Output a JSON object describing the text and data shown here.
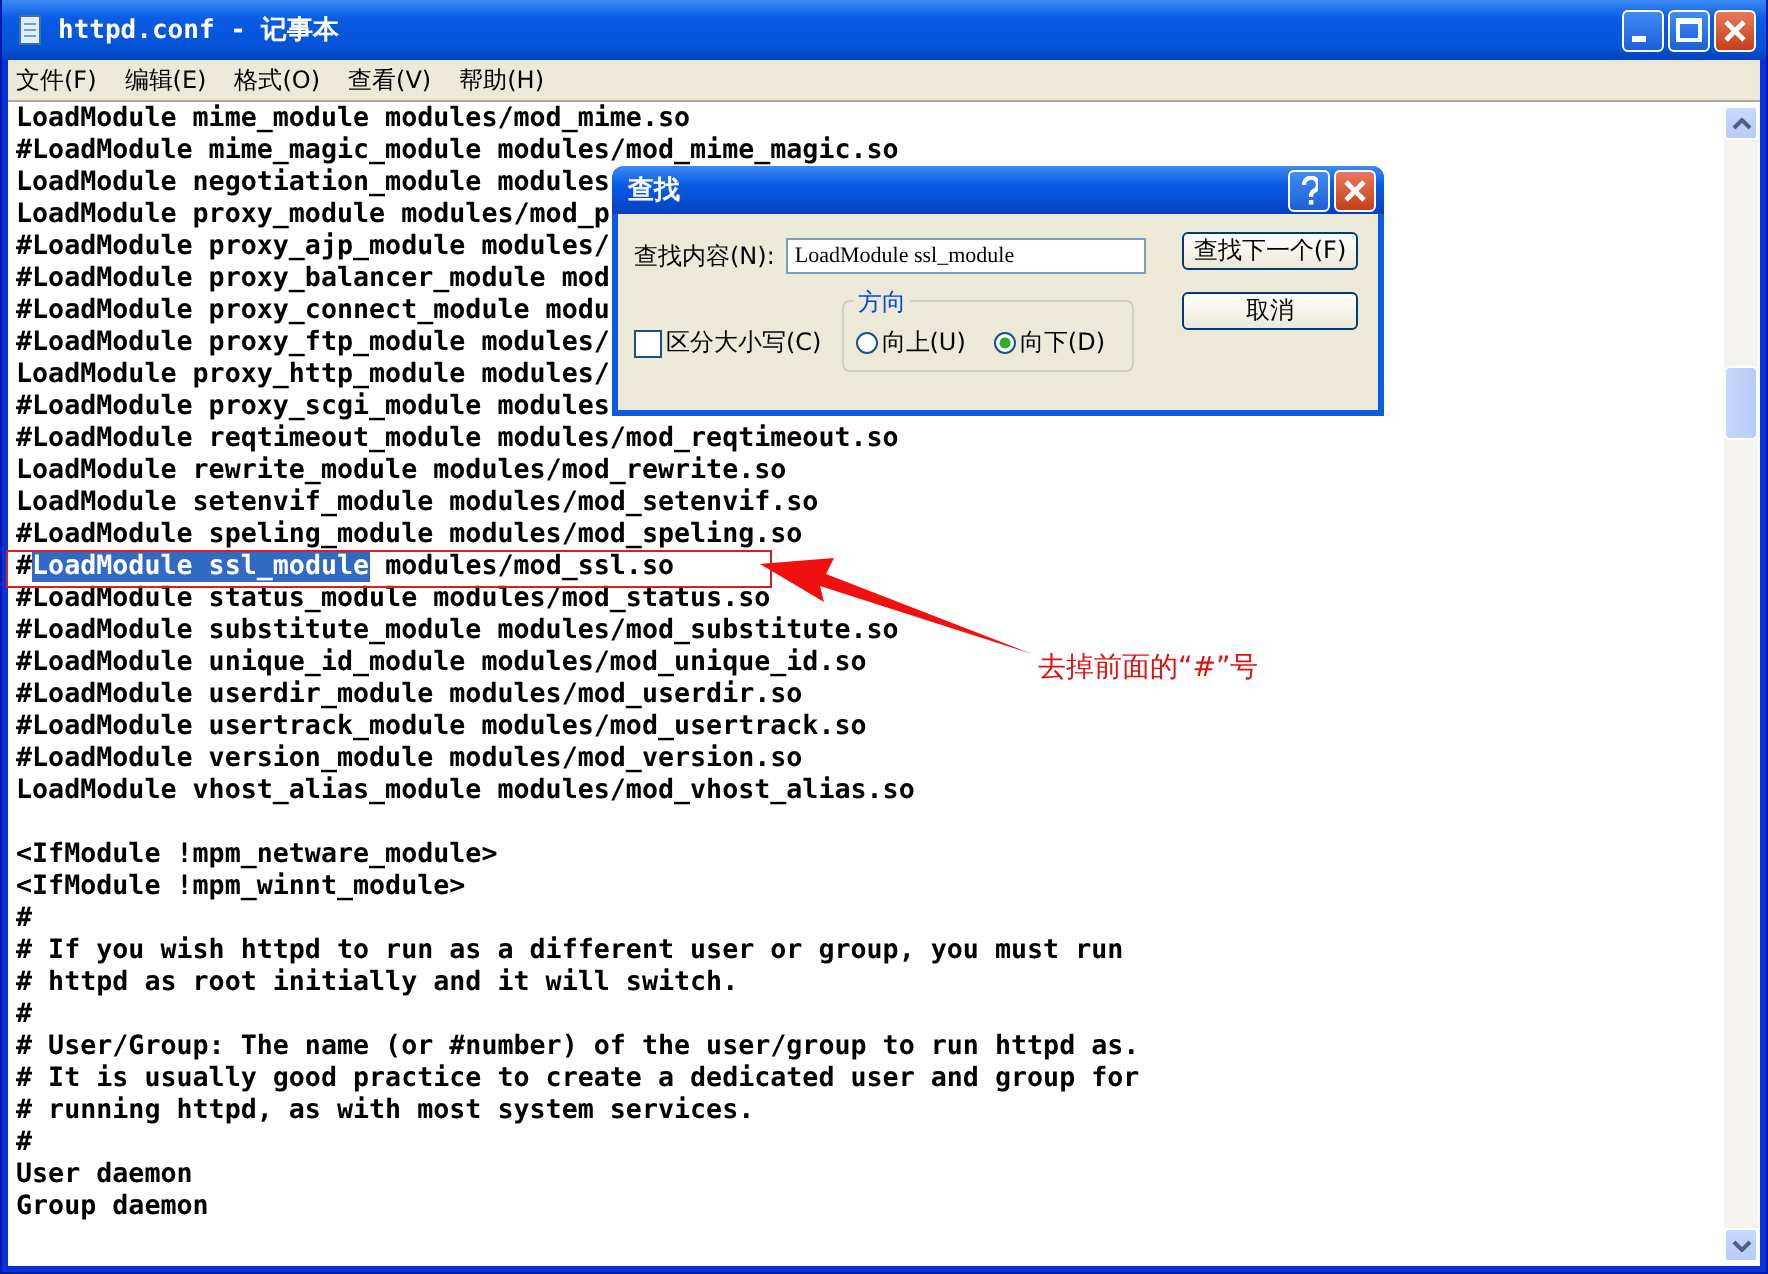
{
  "window": {
    "title": "httpd.conf - 记事本"
  },
  "menu": [
    {
      "label": "文件(F)"
    },
    {
      "label": "编辑(E)"
    },
    {
      "label": "格式(O)"
    },
    {
      "label": "查看(V)"
    },
    {
      "label": "帮助(H)"
    }
  ],
  "editor": {
    "lines": [
      {
        "text": "LoadModule mime_module modules/mod_mime.so"
      },
      {
        "text": "#LoadModule mime_magic_module modules/mod_mime_magic.so"
      },
      {
        "text": "LoadModule negotiation_module modules"
      },
      {
        "text": "LoadModule proxy_module modules/mod_p"
      },
      {
        "text": "#LoadModule proxy_ajp_module modules/"
      },
      {
        "text": "#LoadModule proxy_balancer_module mod"
      },
      {
        "text": "#LoadModule proxy_connect_module modu"
      },
      {
        "text": "#LoadModule proxy_ftp_module modules/"
      },
      {
        "text": "LoadModule proxy_http_module modules/"
      },
      {
        "text": "#LoadModule proxy_scgi_module modules"
      },
      {
        "text": "#LoadModule reqtimeout_module modules/mod_reqtimeout.so"
      },
      {
        "text": "LoadModule rewrite_module modules/mod_rewrite.so"
      },
      {
        "text": "LoadModule setenvif_module modules/mod_setenvif.so"
      },
      {
        "text": "#LoadModule speling_module modules/mod_speling.so"
      },
      {
        "kind": "highlighted",
        "before": "#",
        "selected": "LoadModule ssl_module",
        "after": " modules/mod_ssl.so"
      },
      {
        "text": "#LoadModule status_module modules/mod_status.so"
      },
      {
        "text": "#LoadModule substitute_module modules/mod_substitute.so"
      },
      {
        "text": "#LoadModule unique_id_module modules/mod_unique_id.so"
      },
      {
        "text": "#LoadModule userdir_module modules/mod_userdir.so"
      },
      {
        "text": "#LoadModule usertrack_module modules/mod_usertrack.so"
      },
      {
        "text": "#LoadModule version_module modules/mod_version.so"
      },
      {
        "text": "LoadModule vhost_alias_module modules/mod_vhost_alias.so"
      },
      {
        "kind": "blank"
      },
      {
        "text": "<IfModule !mpm_netware_module>"
      },
      {
        "text": "<IfModule !mpm_winnt_module>"
      },
      {
        "text": "#"
      },
      {
        "text": "# If you wish httpd to run as a different user or group, you must run"
      },
      {
        "text": "# httpd as root initially and it will switch."
      },
      {
        "text": "#"
      },
      {
        "text": "# User/Group: The name (or #number) of the user/group to run httpd as."
      },
      {
        "text": "# It is usually good practice to create a dedicated user and group for"
      },
      {
        "text": "# running httpd, as with most system services."
      },
      {
        "text": "#"
      },
      {
        "text": "User daemon"
      },
      {
        "text": "Group daemon"
      }
    ]
  },
  "annotation": {
    "label": "去掉前面的“#”号"
  },
  "find_dialog": {
    "title": "查找",
    "find_label": "查找内容(N):",
    "find_value": "LoadModule ssl_module",
    "find_next_button": "查找下一个(F)",
    "cancel_button": "取消",
    "match_case": {
      "label": "区分大小写(C)",
      "checked": false
    },
    "direction": {
      "label": "方向",
      "options": [
        {
          "label": "向上(U)",
          "selected": false
        },
        {
          "label": "向下(D)",
          "selected": true
        }
      ]
    }
  }
}
